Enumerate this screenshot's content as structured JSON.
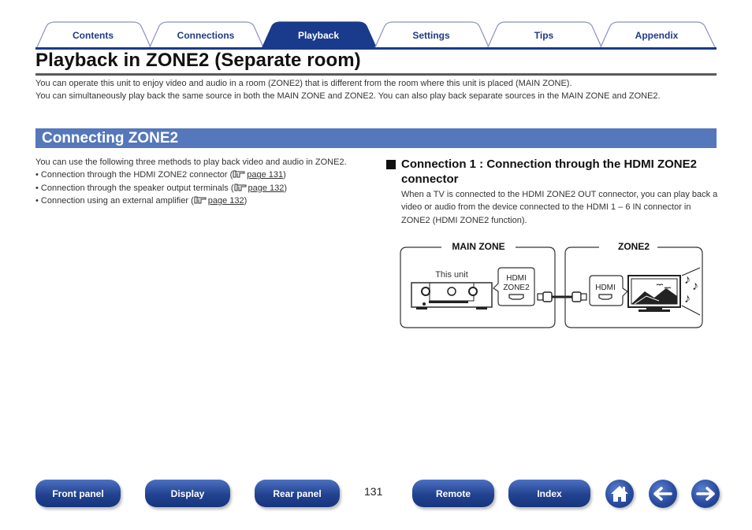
{
  "tabs": [
    {
      "label": "Contents",
      "active": false
    },
    {
      "label": "Connections",
      "active": false
    },
    {
      "label": "Playback",
      "active": true
    },
    {
      "label": "Settings",
      "active": false
    },
    {
      "label": "Tips",
      "active": false
    },
    {
      "label": "Appendix",
      "active": false
    }
  ],
  "colors": {
    "brand": "#1a3a8c",
    "section": "#5577bb",
    "tab_text": "#1f3b87",
    "tab_border": "#8a90c0"
  },
  "page": {
    "title": "Playback in ZONE2 (Separate room)",
    "intro": [
      "You can operate this unit to enjoy video and audio in a room (ZONE2) that is different from the room where this unit is placed (MAIN ZONE).",
      "You can simultaneously play back the same source in both the MAIN ZONE and ZONE2. You can also play back separate sources in the MAIN ZONE and ZONE2."
    ]
  },
  "section": {
    "title": "Connecting ZONE2",
    "lead": "You can use the following three methods to play back video and audio in ZONE2.",
    "methods": [
      {
        "text": "• Connection through the HDMI ZONE2 connector (",
        "link": "page 131",
        "close": ")"
      },
      {
        "text": "• Connection through the speaker output terminals (",
        "link": "page 132",
        "close": ")"
      },
      {
        "text": "• Connection using an external amplifier (",
        "link": "page 132",
        "close": ")"
      }
    ]
  },
  "connection1": {
    "title": "Connection 1 : Connection through the HDMI ZONE2 connector",
    "description": "When a TV is connected to the HDMI ZONE2 OUT connector, you can play back a video or audio from the device connected to the HDMI 1 – 6 IN connector in ZONE2 (HDMI ZONE2 function)."
  },
  "diagram": {
    "main_zone_label": "MAIN ZONE",
    "zone2_label": "ZONE2",
    "this_unit_label": "This unit",
    "main_port_line1": "HDMI",
    "main_port_line2": "ZONE2",
    "tv_port_label": "HDMI"
  },
  "footer": {
    "buttons": [
      "Front panel",
      "Display",
      "Rear panel",
      "Remote",
      "Index"
    ],
    "page_number": "131",
    "icons": [
      "home-icon",
      "back-arrow-icon",
      "forward-arrow-icon"
    ]
  }
}
